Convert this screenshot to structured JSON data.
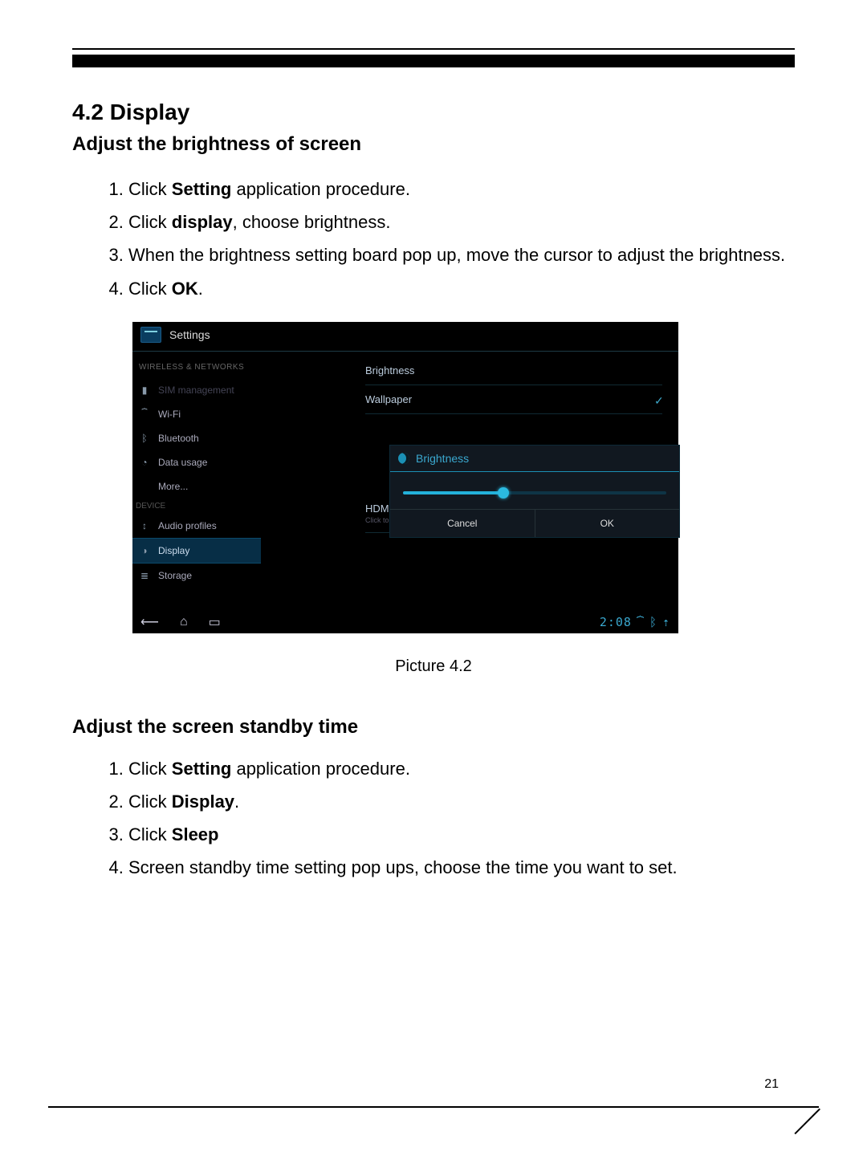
{
  "page_number": "21",
  "section": {
    "title": "4.2 Display",
    "sub1": "Adjust the brightness of screen",
    "steps1": {
      "s1a": "Click ",
      "s1b": "Setting",
      "s1c": " application procedure.",
      "s2a": "Click ",
      "s2b": "display",
      "s2c": ", choose brightness.",
      "s3": "When the brightness setting board pop up, move the cursor to adjust the brightness.",
      "s4a": "Click ",
      "s4b": "OK",
      "s4c": "."
    },
    "caption": "Picture 4.2",
    "sub2": "Adjust the screen standby time",
    "steps2": {
      "s1a": "Click ",
      "s1b": "Setting",
      "s1c": " application procedure.",
      "s2a": "Click ",
      "s2b": "Display",
      "s2c": ".",
      "s3a": "Click ",
      "s3b": "Sleep",
      "s4": "Screen standby time setting pop ups, choose the time you want to set."
    }
  },
  "screenshot": {
    "app_title": "Settings",
    "sidebar": {
      "header1": "WIRELESS & NETWORKS",
      "items": [
        {
          "label": "SIM management"
        },
        {
          "label": "Wi-Fi"
        },
        {
          "label": "Bluetooth"
        },
        {
          "label": "Data usage"
        },
        {
          "label": "More..."
        }
      ],
      "header2": "DEVICE",
      "items2": [
        {
          "label": "Audio profiles"
        },
        {
          "label": "Display"
        },
        {
          "label": "Storage"
        }
      ]
    },
    "main_rows": {
      "r1": "Brightness",
      "r2": "Wallpaper",
      "r3": "HDMI settings",
      "r3sub": "Click to configure HDMI"
    },
    "dialog": {
      "title": "Brightness",
      "cancel": "Cancel",
      "ok": "OK"
    },
    "statusbar": {
      "time": "2:08"
    }
  }
}
